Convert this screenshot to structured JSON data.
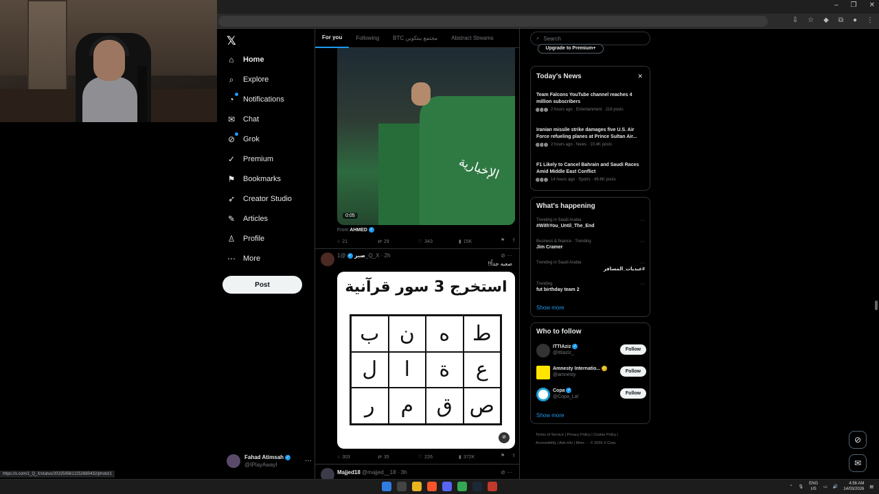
{
  "nav": {
    "logo": "𝕏",
    "items": [
      {
        "label": "Home",
        "icon": "home-icon",
        "glyph": "⌂"
      },
      {
        "label": "Explore",
        "icon": "search-icon",
        "glyph": "⌕"
      },
      {
        "label": "Notifications",
        "icon": "bell-icon",
        "glyph": "🔔"
      },
      {
        "label": "Chat",
        "icon": "chat-icon",
        "glyph": "✉"
      },
      {
        "label": "Grok",
        "icon": "grok-icon",
        "glyph": "⊘"
      },
      {
        "label": "Premium",
        "icon": "premium-icon",
        "glyph": "✓"
      },
      {
        "label": "Bookmarks",
        "icon": "bookmark-icon",
        "glyph": "⚑"
      },
      {
        "label": "Creator Studio",
        "icon": "rocket-icon",
        "glyph": "➶"
      },
      {
        "label": "Articles",
        "icon": "article-icon",
        "glyph": "✎"
      },
      {
        "label": "Profile",
        "icon": "profile-icon",
        "glyph": "♙"
      },
      {
        "label": "More",
        "icon": "more-icon",
        "glyph": "⋯"
      }
    ],
    "post_label": "Post",
    "account": {
      "name": "Fahad Atimsah",
      "handle": "@IPlayAwayI",
      "more": "···"
    }
  },
  "feed": {
    "tabs": [
      "For you",
      "Following",
      "BTC مجتمع بيتكوين",
      "Abstract Streams"
    ],
    "video_time": "0:05",
    "video_overlay_text": "الإخبارية",
    "from_label": "From",
    "from_name": "AHMED",
    "tweet1_actions": {
      "replies": "21",
      "reposts": "29",
      "likes": "343",
      "views": "15K"
    },
    "tweet2": {
      "name": "صبر",
      "handle": "@1_Q_X",
      "time": "· 2h",
      "text": "صعبه جداً!!",
      "puzzle_title": "استخرج 3 سور قرآنية",
      "grid": [
        "ب",
        "ن",
        "ه",
        "ط",
        "ل",
        "ا",
        "ة",
        "ع",
        "ر",
        "م",
        "ق",
        "ص"
      ],
      "alt_label": "ALT",
      "actions": {
        "replies": "303",
        "reposts": "35",
        "likes": "226",
        "views": "372K"
      }
    },
    "tweet3": {
      "name": "Majjed18",
      "handle": "@majjed__18",
      "time": "· 3h"
    }
  },
  "sidebar": {
    "search_placeholder": "Search",
    "upgrade_label": "Upgrade to Premium+",
    "news_title": "Today's News",
    "news_close": "✕",
    "news": [
      {
        "title": "Team Falcons YouTube channel reaches 4 million subscribers",
        "meta": "2 hours ago · Entertainment · 218 posts"
      },
      {
        "title": "Iranian missile strike damages five U.S. Air Force refueling planes at Prince Sultan Air...",
        "meta": "2 hours ago · News · 10.4K posts"
      },
      {
        "title": "F1 Likely to Cancel Bahrain and Saudi Races Amid Middle East Conflict",
        "meta": "14 hours ago · Sports · 49.6K posts"
      }
    ],
    "happening_title": "What's happening",
    "trends": [
      {
        "context": "Trending in Saudi Arabia",
        "name": "#WithYou_Until_The_End"
      },
      {
        "context": "Business & finance · Trending",
        "name": "Jim Cramer"
      },
      {
        "context": "Trending in Saudi Arabia",
        "name": "#عبديات_المسافر"
      },
      {
        "context": "Trending",
        "name": "fut birthday team 2"
      }
    ],
    "show_more": "Show more",
    "follow_title": "Who to follow",
    "follow": [
      {
        "name": "ITTIAziz",
        "handle": "@Ittiaziz_",
        "badge": "blue",
        "button": "Follow"
      },
      {
        "name": "Amnesty Internatio...",
        "handle": "@amnesty",
        "badge": "gold",
        "button": "Follow"
      },
      {
        "name": "Copa",
        "handle": "@Copa_Lal",
        "badge": "blue",
        "button": "Follow"
      }
    ],
    "footer": [
      "Terms of Service",
      "Privacy Policy",
      "Cookie Policy",
      "Accessibility",
      "Ads info",
      "More ···",
      "© 2026 X Corp."
    ]
  },
  "status_url": "https://x.com/1_Q_X/status/2032595612252680432/photo/1",
  "taskbar": {
    "lang_top": "ENG",
    "lang_bottom": "US",
    "time": "4:56 AM",
    "date": "14/03/2026"
  },
  "colors": {
    "accent": "#1d9bf0",
    "bg": "#000000",
    "border": "#2f3336",
    "muted": "#71767b"
  }
}
